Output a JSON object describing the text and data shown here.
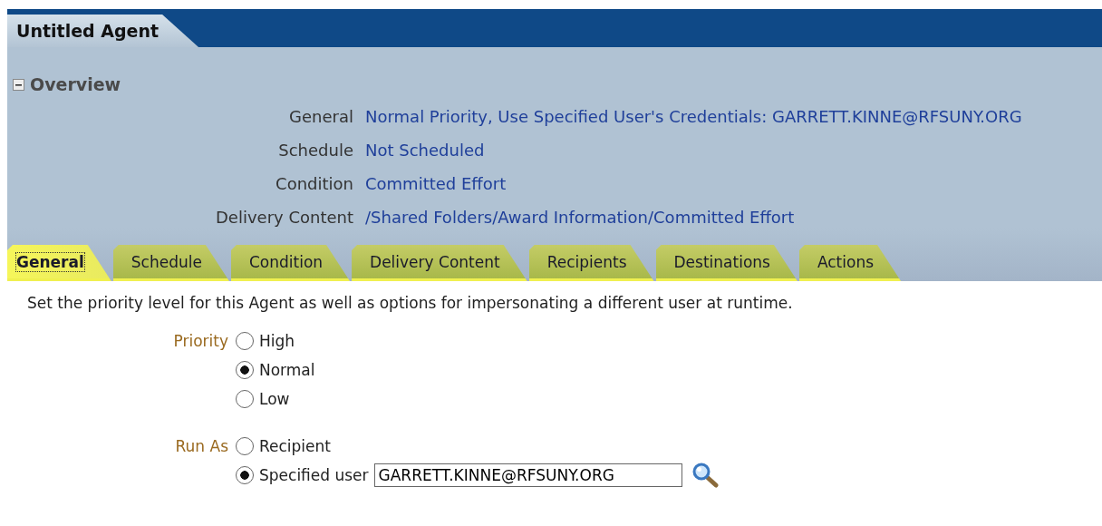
{
  "window": {
    "title": "Untitled Agent"
  },
  "overview": {
    "title": "Overview",
    "expanded": true,
    "rows": [
      {
        "label": "General",
        "value": "Normal Priority, Use Specified User's Credentials: GARRETT.KINNE@RFSUNY.ORG"
      },
      {
        "label": "Schedule",
        "value": "Not Scheduled"
      },
      {
        "label": "Condition",
        "value": "Committed Effort"
      },
      {
        "label": "Delivery Content",
        "value": "/Shared Folders/Award Information/Committed Effort"
      }
    ]
  },
  "tabs": [
    {
      "label": "General",
      "selected": true
    },
    {
      "label": "Schedule",
      "selected": false
    },
    {
      "label": "Condition",
      "selected": false
    },
    {
      "label": "Delivery Content",
      "selected": false
    },
    {
      "label": "Recipients",
      "selected": false
    },
    {
      "label": "Destinations",
      "selected": false
    },
    {
      "label": "Actions",
      "selected": false
    }
  ],
  "description": "Set the priority level for this Agent as well as options for impersonating a different user at runtime.",
  "groups": [
    {
      "label": "Priority",
      "options": [
        {
          "label": "High",
          "selected": false
        },
        {
          "label": "Normal",
          "selected": true
        },
        {
          "label": "Low",
          "selected": false
        }
      ]
    },
    {
      "label": "Run As",
      "options": [
        {
          "label": "Recipient",
          "selected": false
        },
        {
          "label": "Specified user",
          "selected": true,
          "field_value": "GARRETT.KINNE@RFSUNY.ORG"
        }
      ]
    }
  ]
}
